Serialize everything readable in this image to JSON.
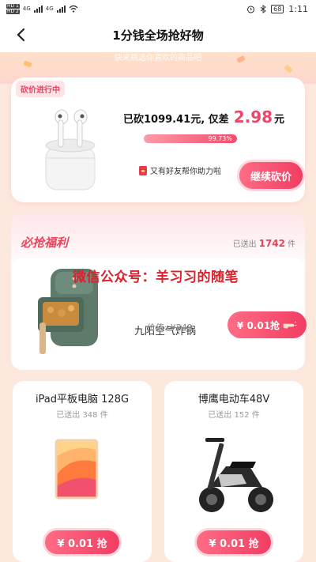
{
  "status_bar": {
    "sim1": "HD 1",
    "sim2": "HD 2",
    "net1": "4G",
    "net2": "4G",
    "battery": "68",
    "time": "1:11"
  },
  "header": {
    "title": "1分钱全场抢好物",
    "back_icon": "chevron-left-icon"
  },
  "banner": {
    "text": "快来挑选你喜欢的商品吧"
  },
  "bargain": {
    "tag": "砍价进行中",
    "cut_prefix": "已砍1099.41元, 仅差",
    "diff_value": "2.98",
    "diff_unit": "元",
    "progress_label": "99.73%",
    "progress_value": 0.9973,
    "friend_msg": "又有好友帮你助力啦",
    "continue_button": "继续砍价"
  },
  "welfare": {
    "title": "必抢福利",
    "sent_prefix": "已送出",
    "sent_count": "1742",
    "sent_suffix": "件",
    "watermark": "微信公众号：羊习习的随笔",
    "featured": {
      "name": "九阳空气炸锅",
      "price_label": "价值:",
      "original_price": "¥249",
      "button": "¥ 0.01抢"
    }
  },
  "products": [
    {
      "name": "iPad平板电脑 128G",
      "sent": "已送出 348 件",
      "button": "¥ 0.01 抢"
    },
    {
      "name": "博鹰电动车48V",
      "sent": "已送出 152 件",
      "button": "¥ 0.01 抢"
    }
  ],
  "colors": {
    "accent": "#f23d63",
    "background": "#fde8de"
  }
}
